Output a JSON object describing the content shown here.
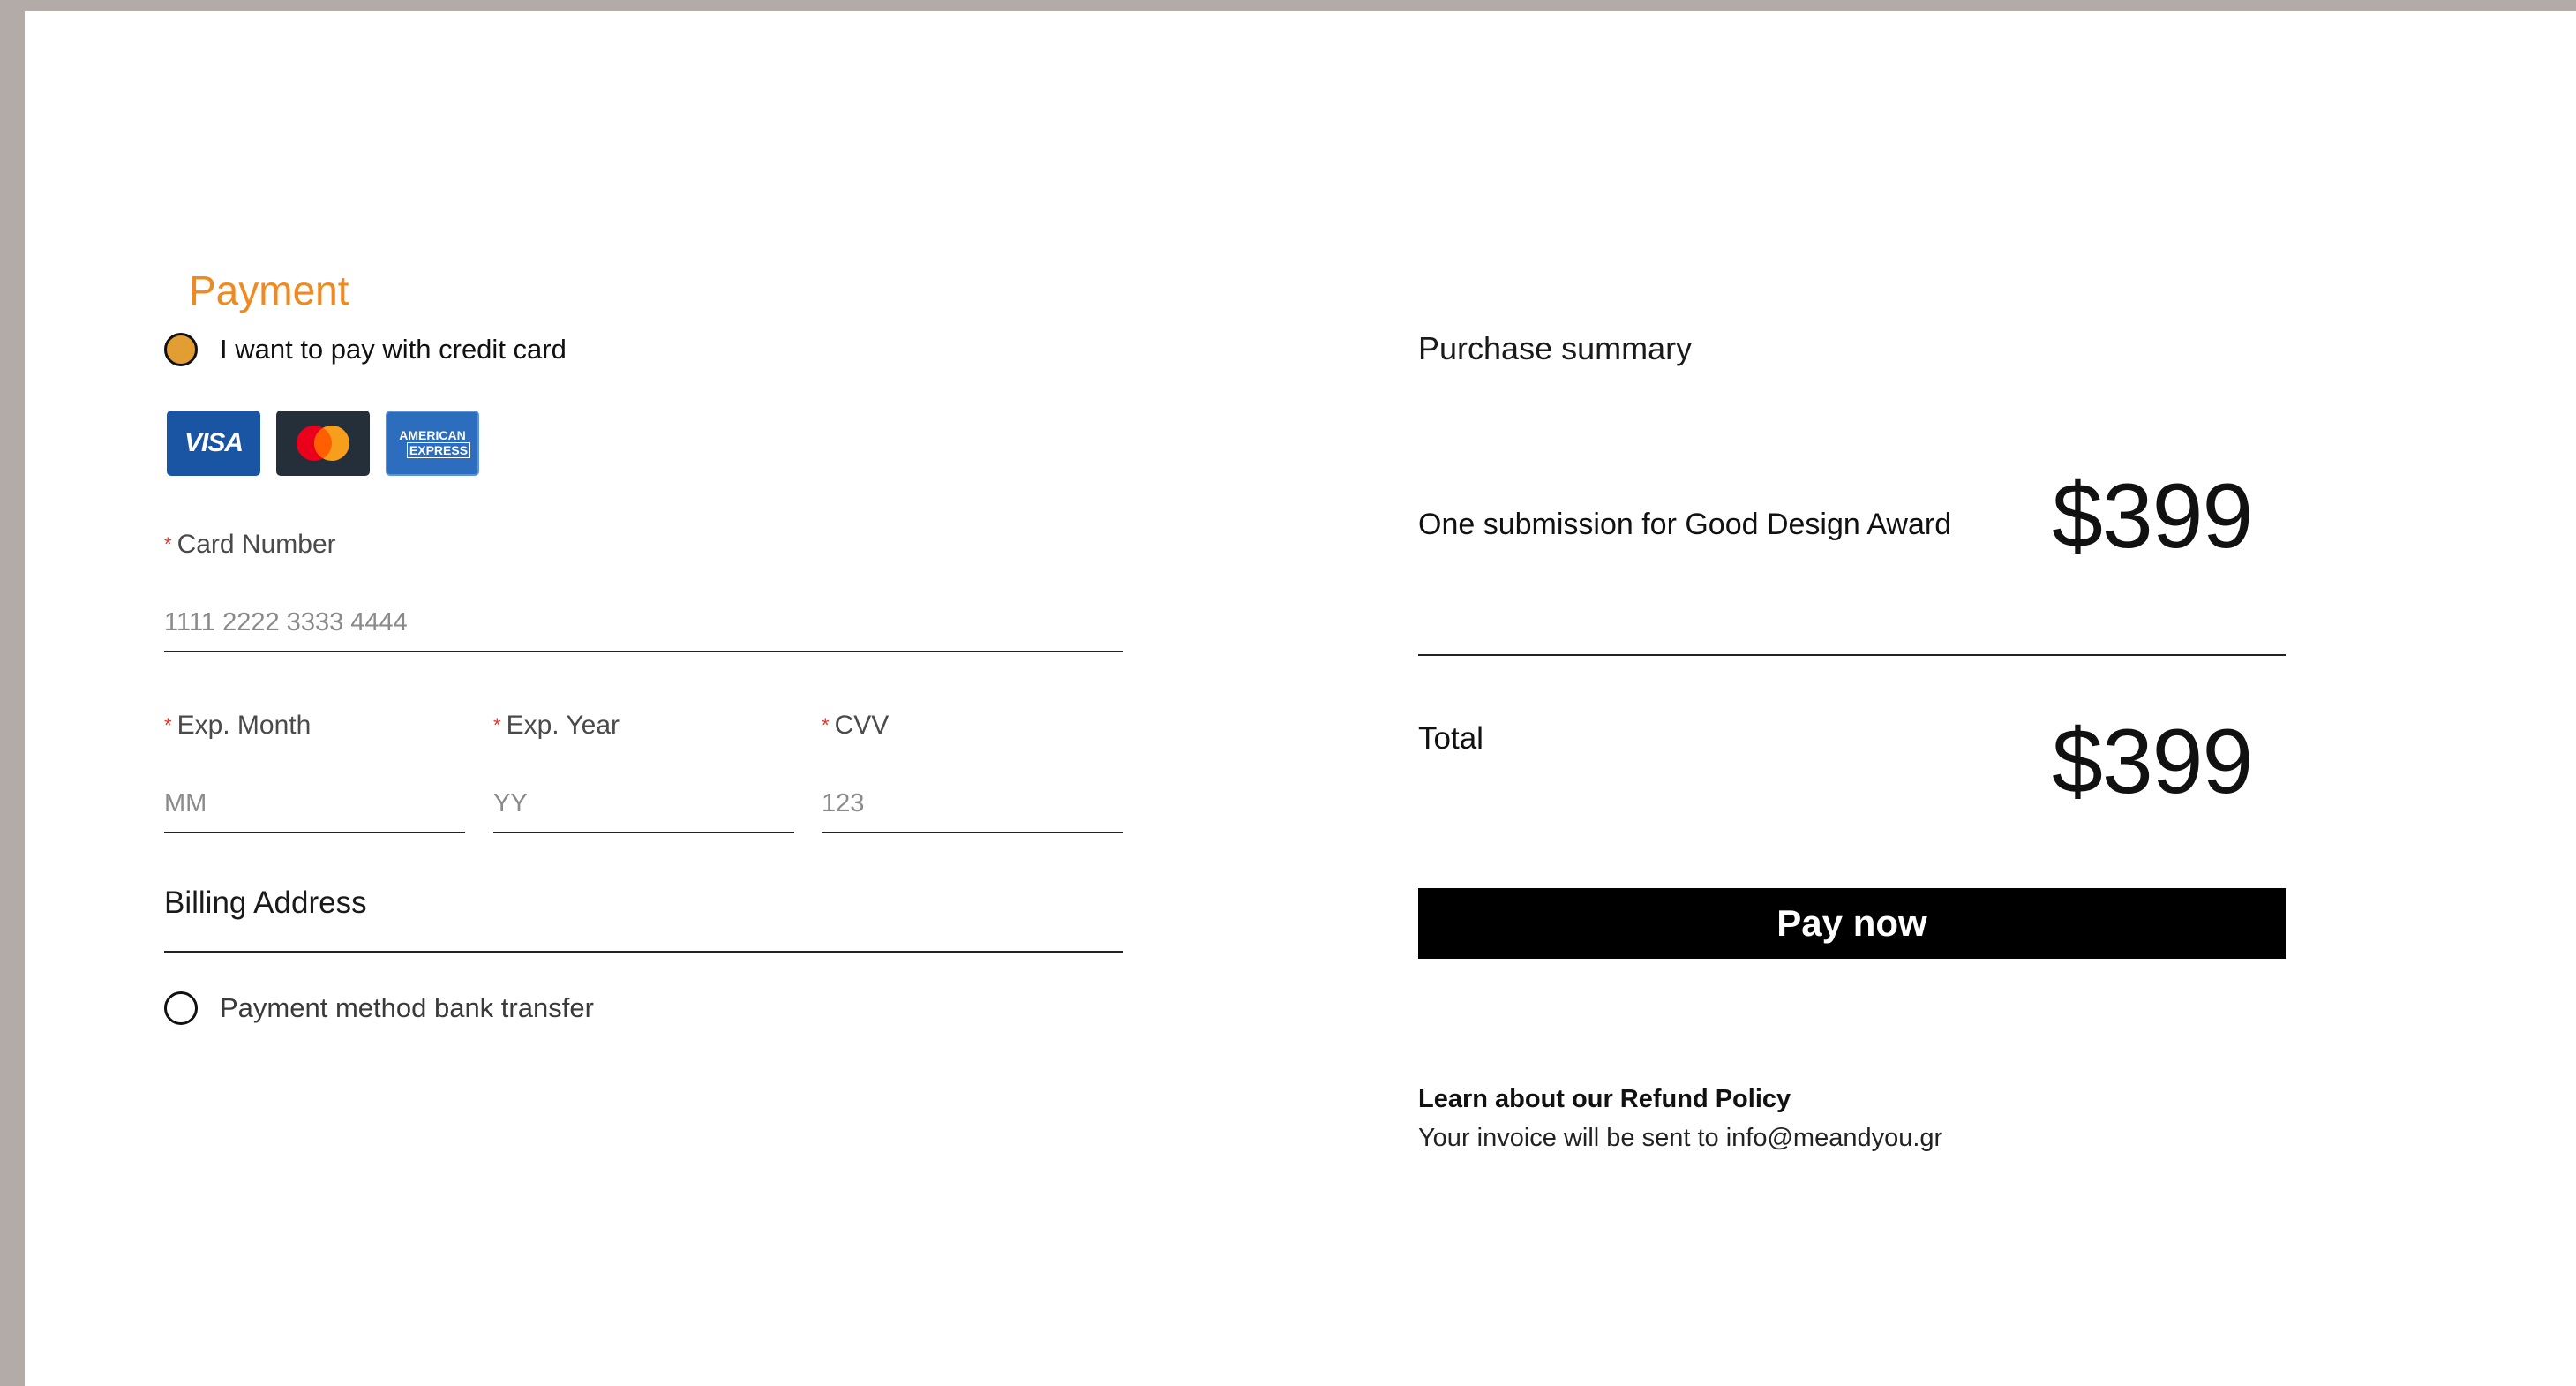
{
  "payment": {
    "title": "Payment",
    "credit_card_option": "I want to pay with credit card",
    "card_logos": {
      "visa": "VISA",
      "amex_line1": "AMERICAN",
      "amex_line2": "EXPRESS"
    },
    "card_number": {
      "label": "Card Number",
      "placeholder": "1111 2222 3333 4444"
    },
    "exp_month": {
      "label": "Exp. Month",
      "placeholder": "MM"
    },
    "exp_year": {
      "label": "Exp. Year",
      "placeholder": "YY"
    },
    "cvv": {
      "label": "CVV",
      "placeholder": "123"
    },
    "required_mark": "*",
    "billing_address_label": "Billing Address",
    "bank_transfer_option": "Payment method bank transfer"
  },
  "summary": {
    "title": "Purchase summary",
    "item_description": "One submission for Good Design Award",
    "item_price": "$399",
    "total_label": "Total",
    "total_price": "$399",
    "pay_button": "Pay now",
    "refund_link": "Learn about our Refund Policy",
    "invoice_note": "Your invoice will be sent to info@meandyou.gr"
  },
  "colors": {
    "accent": "#ef8a21",
    "radio_selected": "#e29e32",
    "required": "#e4342b",
    "button": "#000000"
  }
}
